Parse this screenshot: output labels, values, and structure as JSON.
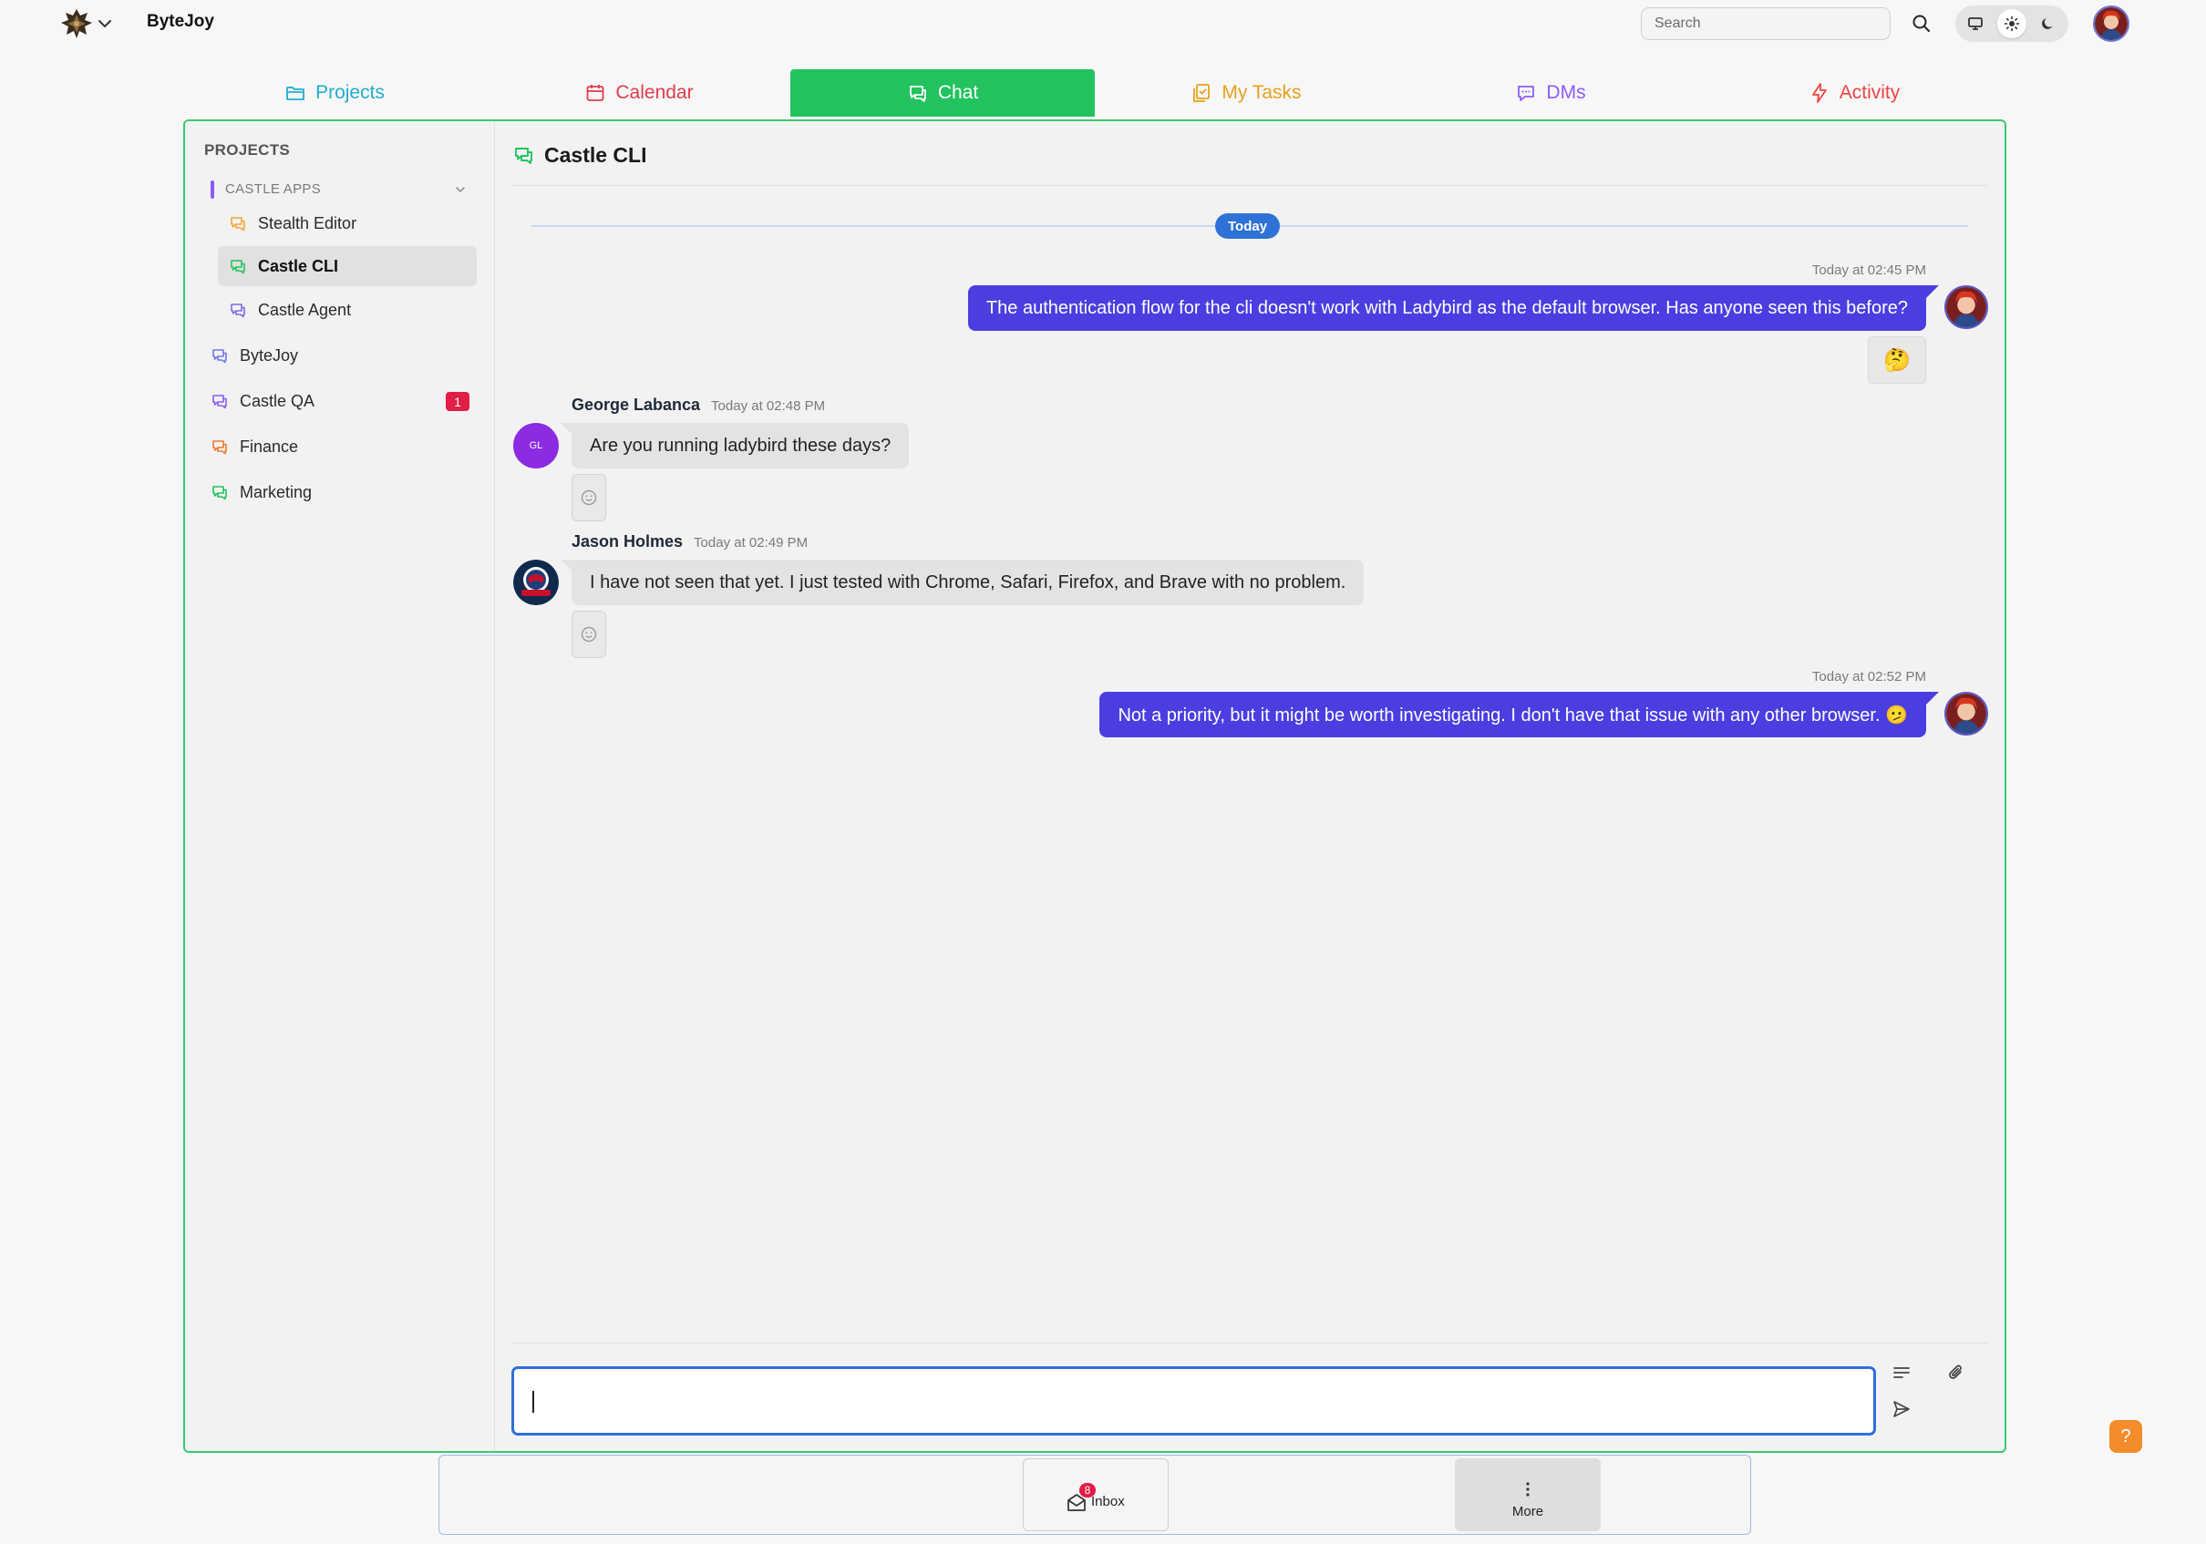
{
  "header": {
    "app_name": "ByteJoy",
    "search_placeholder": "Search",
    "theme_modes": [
      "desktop",
      "light",
      "dark"
    ],
    "active_theme": "light"
  },
  "tabs": [
    {
      "label": "Projects",
      "color": "#21aecb",
      "icon": "folder-icon"
    },
    {
      "label": "Calendar",
      "color": "#e23b4b",
      "icon": "calendar-icon"
    },
    {
      "label": "Chat",
      "color": "#ffffff",
      "icon": "chat-icon",
      "active": true
    },
    {
      "label": "My Tasks",
      "color": "#e6a11c",
      "icon": "tasks-icon"
    },
    {
      "label": "DMs",
      "color": "#8b5cf6",
      "icon": "dm-icon"
    },
    {
      "label": "Activity",
      "color": "#ef4444",
      "icon": "bolt-icon"
    }
  ],
  "sidebar": {
    "title": "PROJECTS",
    "group": {
      "label": "CASTLE APPS",
      "children": [
        {
          "label": "Stealth Editor",
          "icon_color": "#f3a63a"
        },
        {
          "label": "Castle CLI",
          "icon_color": "#22c35e",
          "active": true
        },
        {
          "label": "Castle Agent",
          "icon_color": "#7c6ee6"
        }
      ]
    },
    "projects": [
      {
        "label": "ByteJoy",
        "icon_color": "#6f79e6"
      },
      {
        "label": "Castle QA",
        "icon_color": "#8b5cf6",
        "badge": "1"
      },
      {
        "label": "Finance",
        "icon_color": "#f07a2c"
      },
      {
        "label": "Marketing",
        "icon_color": "#22c35e"
      }
    ]
  },
  "chat": {
    "title": "Castle CLI",
    "day_divider": "Today",
    "messages": [
      {
        "id": "m1",
        "mine": true,
        "time": "Today at 02:45 PM",
        "text": "The authentication flow for the cli doesn't work with Ladybird as the default browser. Has anyone seen this before?",
        "reaction": "🤔"
      },
      {
        "id": "m2",
        "mine": false,
        "sender": "George Labanca",
        "initials": "GL",
        "time": "Today at 02:48 PM",
        "text": "Are you running ladybird these days?"
      },
      {
        "id": "m3",
        "mine": false,
        "sender": "Jason Holmes",
        "time": "Today at 02:49 PM",
        "text": "I have not seen that yet. I just tested with Chrome, Safari, Firefox, and Brave with no problem."
      },
      {
        "id": "m4",
        "mine": true,
        "time": "Today at 02:52 PM",
        "text": "Not a priority, but it might be worth investigating. I don't have that issue with any other browser. 🫤"
      }
    ],
    "composer": {
      "value": ""
    }
  },
  "bottom_bar": {
    "inbox_label": "Inbox",
    "inbox_badge": "8",
    "more_label": "More"
  },
  "help_label": "?",
  "colors": {
    "accent_green": "#22c35e",
    "my_bubble": "#4a3ee0",
    "today_pill": "#2f72d6",
    "badge_red": "#e11d48"
  }
}
